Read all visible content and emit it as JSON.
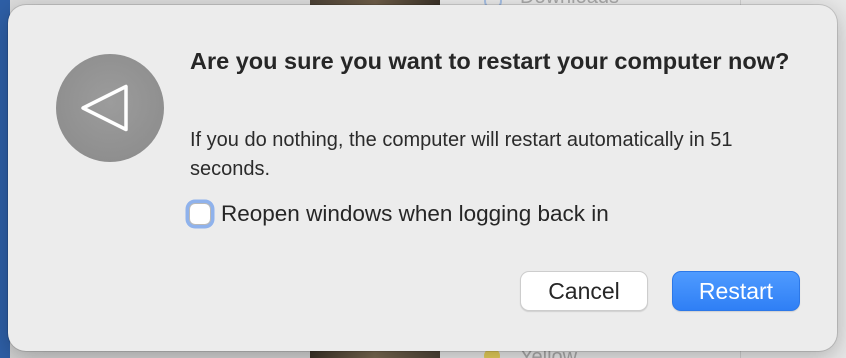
{
  "background": {
    "top_item_label": "Downloads",
    "bottom_item_label": "Yellow"
  },
  "dialog": {
    "icon": "restart-triangle-icon",
    "title": "Are you sure you want to restart your computer now?",
    "message": "If you do nothing, the computer will restart automatically in 51 seconds.",
    "countdown_seconds": 51,
    "checkbox": {
      "label": "Reopen windows when logging back in",
      "checked": false
    },
    "buttons": {
      "cancel_label": "Cancel",
      "restart_label": "Restart"
    }
  },
  "colors": {
    "dialog_bg": "#ececec",
    "icon_bg": "#8f8f8f",
    "accent": "#2f7ff5",
    "focus_ring": "#8fb2ec",
    "text": "#262626"
  }
}
